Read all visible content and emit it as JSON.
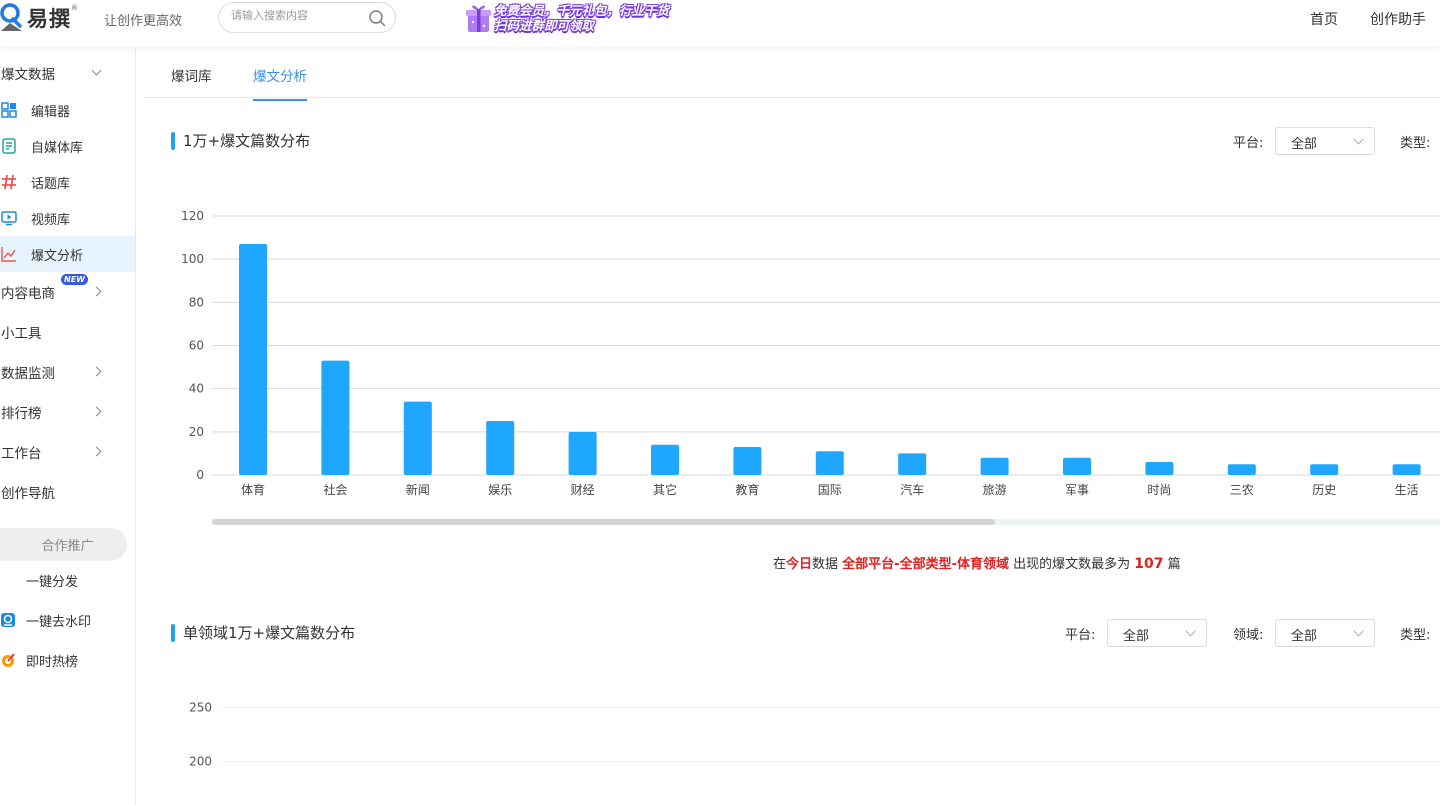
{
  "header": {
    "logo_text": "易撰",
    "logo_reg": "®",
    "slogan": "让创作更高效",
    "search_placeholder": "请输入搜索内容",
    "promo_line1": "免费会员，千元礼包，行业干货",
    "promo_line2": "扫码进群即可领取",
    "nav": [
      "首页",
      "创作助手"
    ]
  },
  "sidebar": {
    "group_data": "爆文数据",
    "items": [
      "编辑器",
      "自媒体库",
      "话题库",
      "视频库",
      "爆文分析"
    ],
    "group_ecom": "内容电商",
    "new_badge": "NEW",
    "groups": [
      "小工具",
      "数据监测",
      "排行榜",
      "工作台",
      "创作导航"
    ],
    "coop": "合作推广",
    "tools": [
      "一键分发",
      "一键去水印",
      "即时热榜"
    ]
  },
  "tabs": [
    "爆词库",
    "爆文分析"
  ],
  "section1": {
    "title": "1万+爆文篇数分布",
    "platform_label": "平台:",
    "platform_value": "全部",
    "type_label": "类型:"
  },
  "summary": {
    "p1": "在",
    "today": "今日",
    "p2": "数据 ",
    "scope": "全部平台-全部类型-体育领域",
    "p3": " 出现的爆文数最多为 ",
    "max": "107",
    "p4": " 篇"
  },
  "section2": {
    "title": "单领域1万+爆文篇数分布",
    "platform_label": "平台:",
    "platform_value": "全部",
    "field_label": "领域:",
    "field_value": "全部",
    "type_label": "类型:"
  },
  "chart_data": [
    {
      "type": "bar",
      "categories": [
        "体育",
        "社会",
        "新闻",
        "娱乐",
        "财经",
        "其它",
        "教育",
        "国际",
        "汽车",
        "旅游",
        "军事",
        "时尚",
        "三农",
        "历史",
        "生活"
      ],
      "values": [
        107,
        53,
        34,
        25,
        20,
        14,
        13,
        11,
        10,
        8,
        8,
        6,
        5,
        5,
        5
      ],
      "ylim": [
        0,
        120
      ],
      "yticks": [
        0,
        20,
        40,
        60,
        80,
        100,
        120
      ],
      "color": "#1ea7fd",
      "grid": true
    },
    {
      "type": "bar",
      "categories": [],
      "values": [],
      "yticks": [
        200,
        250
      ],
      "grid": true
    }
  ],
  "colors": {
    "accent": "#3b8fe6",
    "bar": "#1ea7fd",
    "highlight": "#e02020"
  }
}
